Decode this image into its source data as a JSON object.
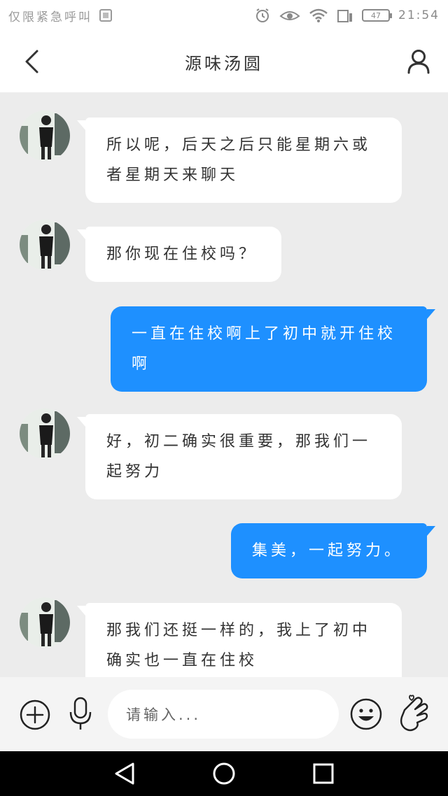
{
  "status_bar": {
    "carrier": "仅限紧急呼叫",
    "battery": "47",
    "time": "21:54"
  },
  "header": {
    "title": "源味汤圆",
    "back_icon": "chevron-left-icon",
    "profile_icon": "user-icon"
  },
  "messages": [
    {
      "side": "in",
      "text": "所以呢，后天之后只能星期六或者星期天来聊天"
    },
    {
      "side": "in",
      "text": "那你现在住校吗？"
    },
    {
      "side": "out",
      "text": "一直在住校啊上了初中就开住校啊"
    },
    {
      "side": "in",
      "text": "好，初二确实很重要，那我们一起努力"
    },
    {
      "side": "out",
      "text": "集美，一起努力。"
    },
    {
      "side": "in",
      "text": "那我们还挺一样的，我上了初中确实也一直在住校"
    }
  ],
  "input_bar": {
    "placeholder": "请输入...",
    "add_icon": "plus-circle-icon",
    "voice_icon": "microphone-icon",
    "emoji_icon": "smiley-icon",
    "gesture_icon": "finger-heart-icon"
  },
  "nav_bar": {
    "back_icon": "triangle-back-icon",
    "home_icon": "circle-home-icon",
    "recent_icon": "square-recent-icon"
  },
  "colors": {
    "accent": "#1e90ff",
    "background": "#ececec",
    "bubble_in": "#ffffff"
  }
}
